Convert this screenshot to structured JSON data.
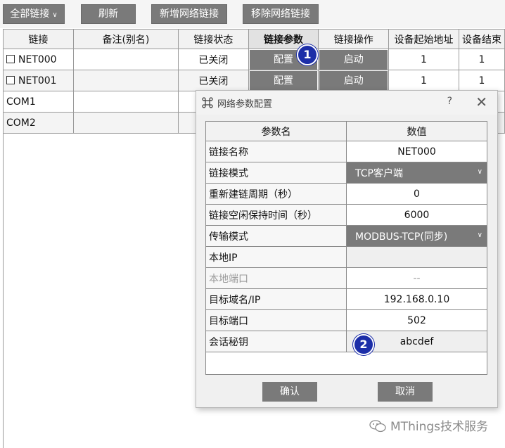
{
  "toolbar": {
    "all_links": "全部链接",
    "refresh": "刷新",
    "add_network_link": "新增网络链接",
    "remove_network_link": "移除网络链接"
  },
  "table": {
    "headers": [
      "链接",
      "备注(别名)",
      "链接状态",
      "链接参数",
      "链接操作",
      "设备起始地址",
      "设备结束"
    ],
    "rows": [
      {
        "link": "NET000",
        "note": "",
        "status": "已关闭",
        "param": "配置",
        "op": "启动",
        "start": "1",
        "end": "1"
      },
      {
        "link": "NET001",
        "note": "",
        "status": "已关闭",
        "param": "配置",
        "op": "启动",
        "start": "1",
        "end": "1"
      },
      {
        "link": "COM1",
        "note": ""
      },
      {
        "link": "COM2",
        "note": ""
      }
    ]
  },
  "badges": {
    "one": "1",
    "two": "2"
  },
  "dialog": {
    "title": "网络参数配置",
    "help": "?",
    "close": "✕",
    "headers": [
      "参数名",
      "数值"
    ],
    "params": [
      {
        "name": "链接名称",
        "value": "NET000"
      },
      {
        "name": "链接模式",
        "value": "TCP客户端"
      },
      {
        "name": "重新建链周期（秒）",
        "value": "0"
      },
      {
        "name": "链接空闲保持时间（秒）",
        "value": "6000"
      },
      {
        "name": "传输模式",
        "value": "MODBUS-TCP(同步)"
      },
      {
        "name": "本地IP",
        "value": ""
      },
      {
        "name": "本地端口",
        "value": "--"
      },
      {
        "name": "目标域名/IP",
        "value": "192.168.0.10"
      },
      {
        "name": "目标端口",
        "value": "502"
      },
      {
        "name": "会话秘钥",
        "value": "abcdef"
      }
    ],
    "confirm": "确认",
    "cancel": "取消"
  },
  "watermark": "MThings技术服务",
  "colors": {
    "button": "#7a7a7a",
    "badge": "#1c2ea8"
  }
}
